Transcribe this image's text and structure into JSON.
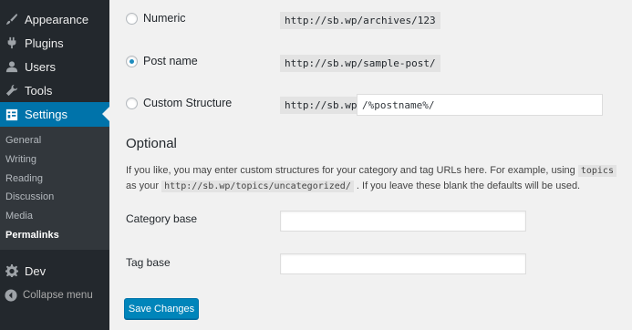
{
  "sidebar": {
    "items": [
      {
        "label": "Appearance",
        "icon": "paintbrush-icon"
      },
      {
        "label": "Plugins",
        "icon": "plug-icon"
      },
      {
        "label": "Users",
        "icon": "user-icon"
      },
      {
        "label": "Tools",
        "icon": "wrench-icon"
      },
      {
        "label": "Settings",
        "icon": "settings-icon"
      }
    ],
    "submenu": [
      "General",
      "Writing",
      "Reading",
      "Discussion",
      "Media",
      "Permalinks"
    ],
    "dev_label": "Dev",
    "collapse_label": "Collapse menu"
  },
  "permalink_options": [
    {
      "label": "Numeric",
      "sample": "http://sb.wp/archives/123",
      "selected": false
    },
    {
      "label": "Post name",
      "sample": "http://sb.wp/sample-post/",
      "selected": true
    },
    {
      "label": "Custom Structure",
      "prefix": "http://sb.wp",
      "value": "/%postname%/",
      "selected": false
    }
  ],
  "optional": {
    "heading": "Optional",
    "desc_part1": "If you like, you may enter custom structures for your category and tag URLs here. For example, using",
    "desc_code1": "topics",
    "desc_part2": "as your",
    "desc_code2": "http://sb.wp/topics/uncategorized/",
    "desc_part3": ". If you leave these blank the defaults will be used.",
    "category_label": "Category base",
    "category_value": "",
    "tag_label": "Tag base",
    "tag_value": ""
  },
  "save_label": "Save Changes",
  "colors": {
    "sidebar_bg": "#23282d",
    "active": "#0073aa",
    "button": "#0085ba",
    "page_bg": "#f1f1f1"
  }
}
